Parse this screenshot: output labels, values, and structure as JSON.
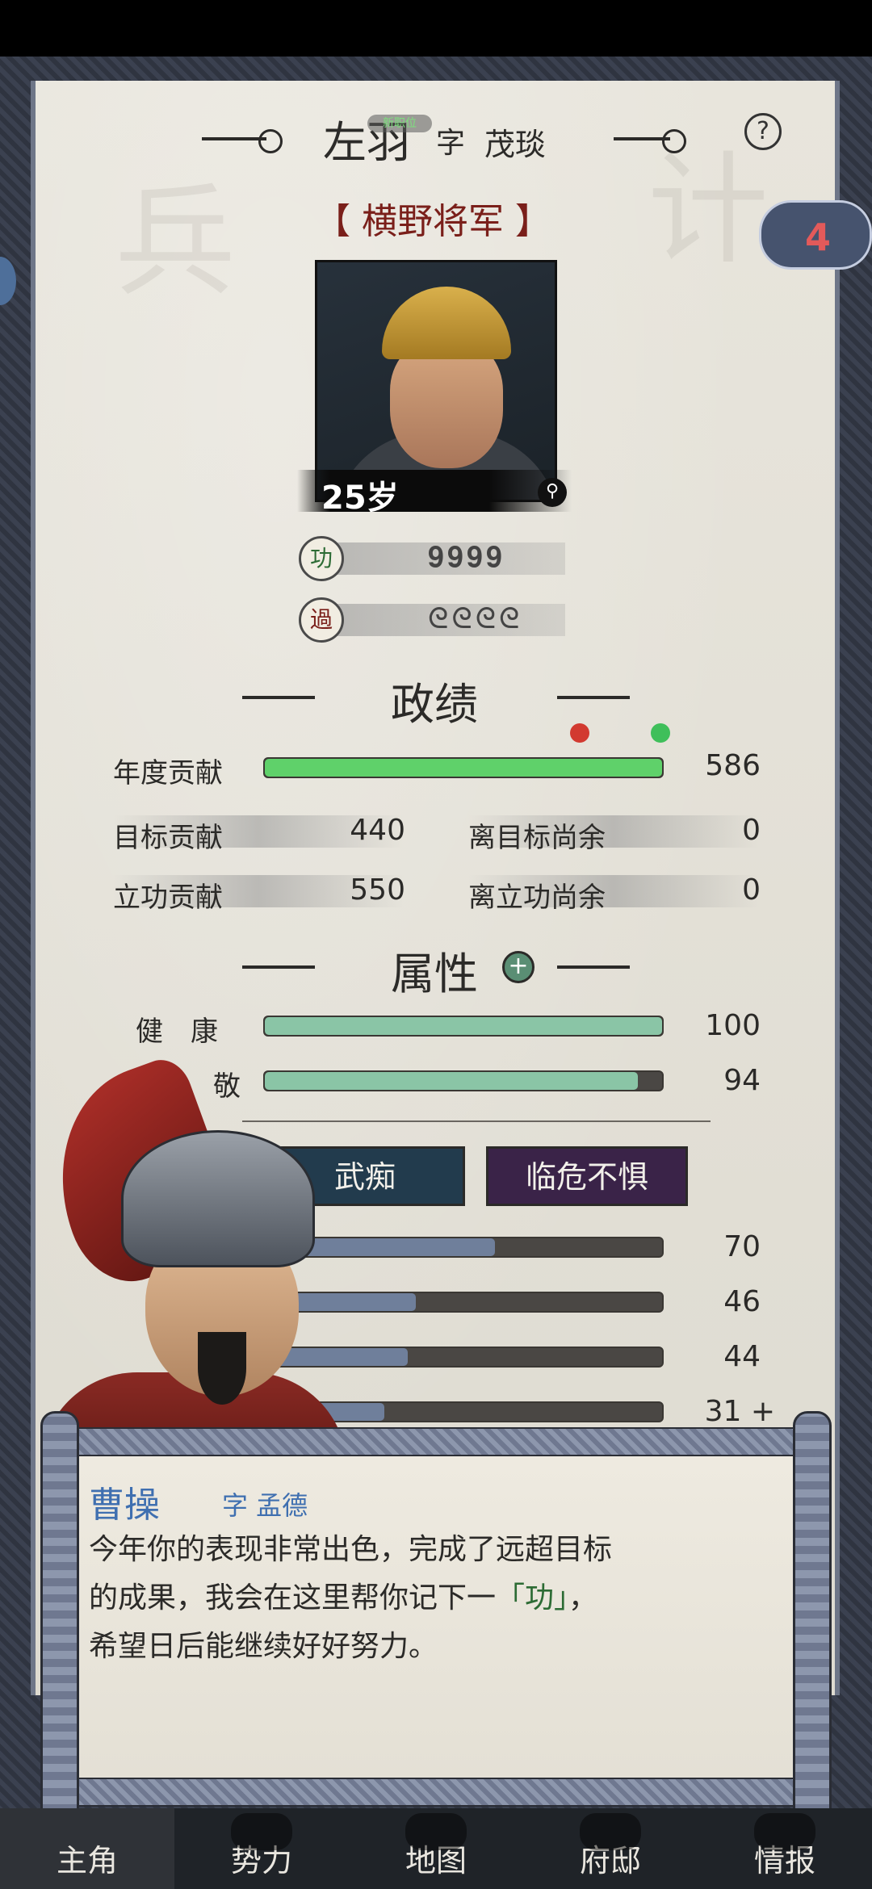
{
  "header": {
    "name": "左羽",
    "zi_label": "字",
    "zi": "茂琰",
    "new_tag": "新职位",
    "help": "?"
  },
  "rank": "【 横野将军 】",
  "badge": {
    "count": "4"
  },
  "portrait": {
    "age": "25岁"
  },
  "merit": {
    "label": "功",
    "icons": "𝟗𝟗𝟗𝟗"
  },
  "demerit": {
    "label": "過",
    "icons": "ᘓᘓᘓᘓ"
  },
  "performance": {
    "title": "政绩",
    "annual_label": "年度贡献",
    "annual_value": "586",
    "annual_progress": 1.0,
    "target_label": "目标贡献",
    "target_value": "440",
    "merit_label": "立功贡献",
    "merit_value": "550",
    "to_target_label": "离目标尚余",
    "to_target_value": "0",
    "to_merit_label": "离立功尚余",
    "to_merit_value": "0"
  },
  "attributes": {
    "title": "属性",
    "plus": "+",
    "health_label": "健　康",
    "health_value": "100",
    "health_fill": 1.0,
    "second_label": "敬",
    "second_value": "94",
    "second_fill": 0.94,
    "traits": [
      "武痴",
      "临危不惧"
    ],
    "stats": [
      {
        "value": "70",
        "fill": 0.58
      },
      {
        "value": "46",
        "fill": 0.38
      },
      {
        "value": "44",
        "fill": 0.36
      },
      {
        "value": "31 +",
        "fill": 0.3
      }
    ]
  },
  "dialog": {
    "speaker": "曹操",
    "speaker_zi": "字 孟德",
    "line1": "今年你的表现非常出色，完成了远超目标",
    "line2_a": "的成果，我会在这里帮你记下一",
    "line2_b": "「功」",
    "line2_c": "，",
    "line3": "希望日后能继续好好努力。"
  },
  "nav": [
    "主角",
    "势力",
    "地图",
    "府邸",
    "情报"
  ],
  "colors": {
    "green_bar": "#5fd16a",
    "teal_bar": "#8ac5a6",
    "trait_a": "#223b4d",
    "trait_b": "#3a2348",
    "speaker": "#3f6fb0",
    "rank": "#7a1f1a"
  }
}
